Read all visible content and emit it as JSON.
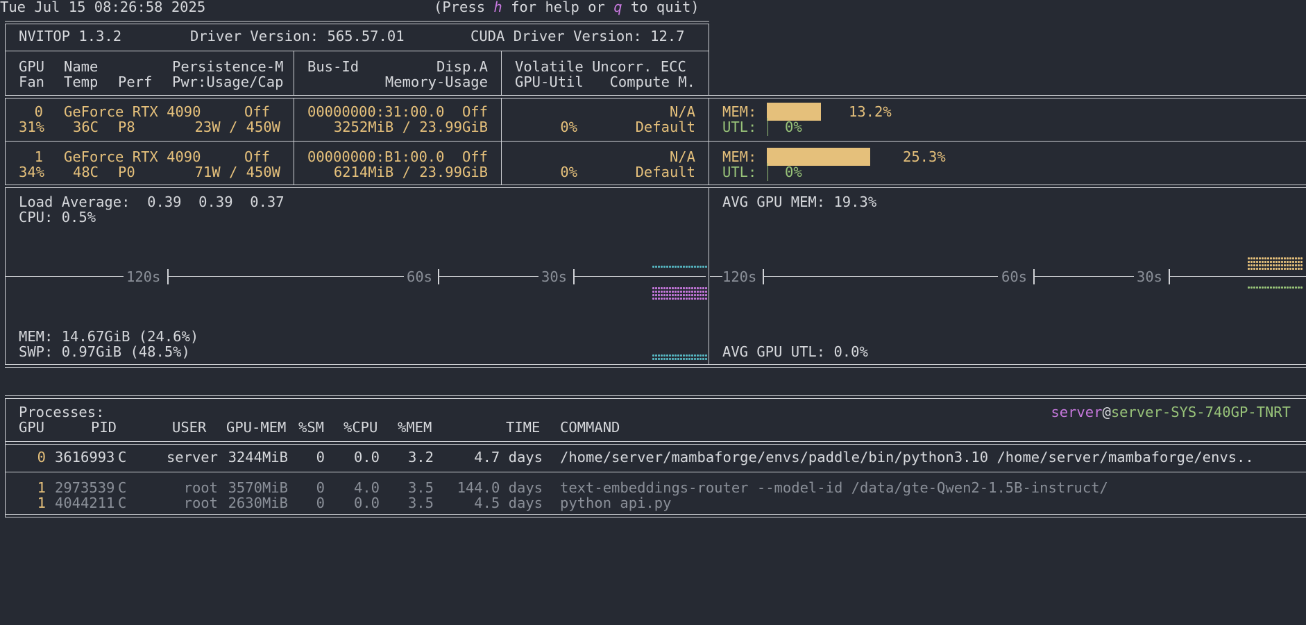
{
  "header": {
    "datetime": "Tue Jul 15 08:26:58 2025",
    "help_pre": "(Press ",
    "help_key": "h",
    "help_mid": " for help or ",
    "quit_key": "q",
    "help_post": " to quit)"
  },
  "info": {
    "version": "NVITOP 1.3.2",
    "driver": "Driver Version: 565.57.01",
    "cuda": "CUDA Driver Version: 12.7"
  },
  "columns": {
    "gpu": "GPU",
    "name": "Name",
    "persistence": "Persistence-M",
    "fan": "Fan",
    "temp": "Temp",
    "perf": "Perf",
    "pwr": "Pwr:Usage/Cap",
    "busid": "Bus-Id",
    "dispa": "Disp.A",
    "memusage": "Memory-Usage",
    "volatile": "Volatile Uncorr. ECC",
    "gpuutil": "GPU-Util",
    "compute": "Compute M."
  },
  "gpus": [
    {
      "index": "0",
      "name": "GeForce RTX 4090",
      "persistence": "Off",
      "fan": "31%",
      "temp": "36C",
      "perf": "P8",
      "power": "23W / 450W",
      "bus_id": "00000000:31:00.0",
      "disp": "Off",
      "memory": "3252MiB / 23.99GiB",
      "ecc": "N/A",
      "util": "0%",
      "compute": "Default",
      "mem_label": "MEM:",
      "mem_pct": "13.2%",
      "mem_frac": 0.132,
      "utl_label": "UTL:",
      "utl_pct": "0%"
    },
    {
      "index": "1",
      "name": "GeForce RTX 4090",
      "persistence": "Off",
      "fan": "34%",
      "temp": "48C",
      "perf": "P0",
      "power": "71W / 450W",
      "bus_id": "00000000:B1:00.0",
      "disp": "Off",
      "memory": "6214MiB / 23.99GiB",
      "ecc": "N/A",
      "util": "0%",
      "compute": "Default",
      "mem_label": "MEM:",
      "mem_pct": "25.3%",
      "mem_frac": 0.253,
      "utl_label": "UTL:",
      "utl_pct": "0%"
    }
  ],
  "host": {
    "load_avg": "Load Average:  0.39  0.39  0.37",
    "cpu": "CPU: 0.5%",
    "mem": "MEM: 14.67GiB (24.6%)",
    "swp": "SWP: 0.97GiB (48.5%)",
    "avg_gpu_mem": "AVG GPU MEM: 19.3%",
    "avg_gpu_utl": "AVG GPU UTL: 0.0%",
    "time_labels": [
      "120s",
      "60s",
      "30s"
    ]
  },
  "processes": {
    "title": "Processes:",
    "user": "server",
    "at": "@",
    "hostname": "server-SYS-740GP-TNRT",
    "headers": {
      "gpu": "GPU",
      "pid": "PID",
      "user": "USER",
      "gpumem": "GPU-MEM",
      "sm": "%SM",
      "cpu": "%CPU",
      "mem": "%MEM",
      "time": "TIME",
      "command": "COMMAND"
    },
    "rows": [
      {
        "gpu": "0",
        "pid": "3616993",
        "type": "C",
        "user": "server",
        "gpumem": "3244MiB",
        "sm": "0",
        "cpu": "0.0",
        "mem": "3.2",
        "time": "4.7 days",
        "command": "/home/server/mambaforge/envs/paddle/bin/python3.10 /home/server/mambaforge/envs.."
      },
      {
        "gpu": "1",
        "pid": "2973539",
        "type": "C",
        "user": "root",
        "gpumem": "3570MiB",
        "sm": "0",
        "cpu": "4.0",
        "mem": "3.5",
        "time": "144.0 days",
        "command": "text-embeddings-router --model-id /data/gte-Qwen2-1.5B-instruct/"
      },
      {
        "gpu": "1",
        "pid": "4044211",
        "type": "C",
        "user": "root",
        "gpumem": "2630MiB",
        "sm": "0",
        "cpu": "0.0",
        "mem": "3.5",
        "time": "4.5 days",
        "command": "python api.py"
      }
    ]
  },
  "colors": {
    "background": "#262a33",
    "text": "#d6d8dc",
    "yellow": "#e5c07b",
    "green": "#98c379",
    "magenta": "#c678dd",
    "cyan": "#56b6c2",
    "dim": "#8a8f98"
  }
}
